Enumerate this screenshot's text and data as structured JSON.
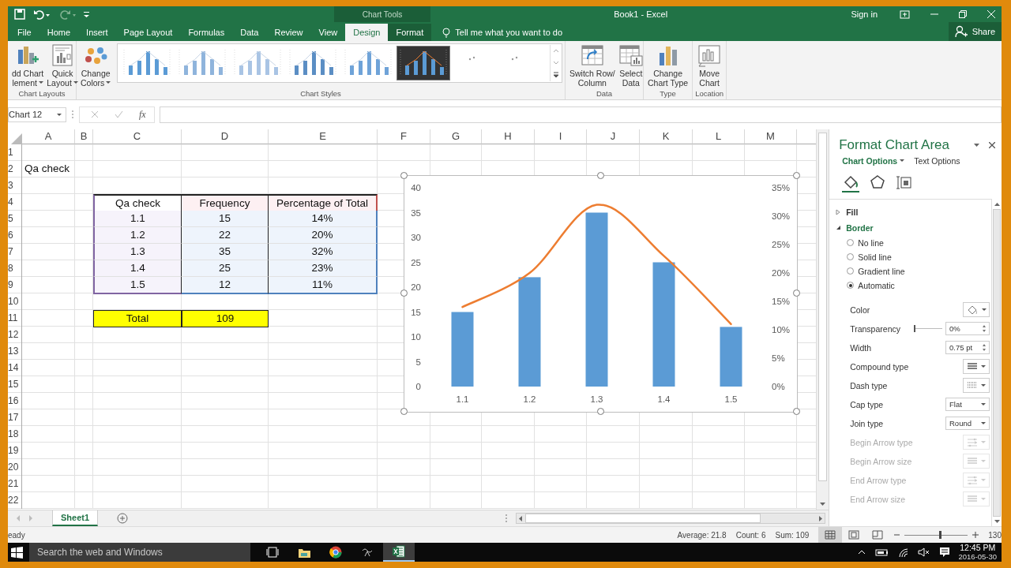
{
  "title_bar": {
    "context_label": "Chart Tools",
    "title": "Book1 - Excel",
    "sign_in": "Sign in"
  },
  "ribbon_tabs": [
    {
      "label": "File",
      "selected": false,
      "contextual": false
    },
    {
      "label": "Home",
      "selected": false,
      "contextual": false
    },
    {
      "label": "Insert",
      "selected": false,
      "contextual": false
    },
    {
      "label": "Page Layout",
      "selected": false,
      "contextual": false
    },
    {
      "label": "Formulas",
      "selected": false,
      "contextual": false
    },
    {
      "label": "Data",
      "selected": false,
      "contextual": false
    },
    {
      "label": "Review",
      "selected": false,
      "contextual": false
    },
    {
      "label": "View",
      "selected": false,
      "contextual": false
    },
    {
      "label": "Design",
      "selected": true,
      "contextual": true
    },
    {
      "label": "Format",
      "selected": false,
      "contextual": true
    }
  ],
  "tell_me": "Tell me what you want to do",
  "share": "Share",
  "ribbon_groups": [
    {
      "label": "Chart Layouts",
      "buttons": [
        {
          "lines": [
            "dd Chart",
            "lement"
          ],
          "dropdown": true
        },
        {
          "lines": [
            "Quick",
            "Layout"
          ],
          "dropdown": true
        }
      ]
    },
    {
      "label": "Chart Styles",
      "buttons": [
        {
          "lines": [
            "Change",
            "Colors"
          ],
          "dropdown": true
        }
      ],
      "gallery": [
        {
          "kind": "style",
          "selected": false
        },
        {
          "kind": "style",
          "selected": false
        },
        {
          "kind": "style",
          "selected": false
        },
        {
          "kind": "style",
          "selected": false
        },
        {
          "kind": "style",
          "selected": false
        },
        {
          "kind": "style",
          "selected": true
        },
        {
          "kind": "placeholder",
          "selected": false
        },
        {
          "kind": "placeholder",
          "selected": false
        }
      ]
    },
    {
      "label": "Data",
      "buttons": [
        {
          "lines": [
            "Switch Row/",
            "Column"
          ],
          "dropdown": false
        },
        {
          "lines": [
            "Select",
            "Data"
          ],
          "dropdown": false
        }
      ]
    },
    {
      "label": "Type",
      "buttons": [
        {
          "lines": [
            "Change",
            "Chart Type"
          ],
          "dropdown": false
        }
      ]
    },
    {
      "label": "Location",
      "buttons": [
        {
          "lines": [
            "Move",
            "Chart"
          ],
          "dropdown": false
        }
      ]
    }
  ],
  "formula_bar": {
    "name_box": "Chart 12",
    "function_label": "fx"
  },
  "sheet": {
    "columns": [
      "A",
      "B",
      "C",
      "D",
      "E",
      "F",
      "G",
      "H",
      "I",
      "J",
      "K",
      "L",
      "M"
    ],
    "rows": [
      {
        "number": "1"
      },
      {
        "number": "2",
        "label": "Qa check"
      },
      {
        "number": "3"
      },
      {
        "number": "4"
      },
      {
        "number": "5"
      },
      {
        "number": "6"
      },
      {
        "number": "7"
      },
      {
        "number": "8"
      },
      {
        "number": "9"
      },
      {
        "number": "10"
      },
      {
        "number": "11"
      },
      {
        "number": "12"
      },
      {
        "number": "13"
      },
      {
        "number": "14"
      },
      {
        "number": "15"
      },
      {
        "number": "16"
      },
      {
        "number": "17"
      },
      {
        "number": "18"
      },
      {
        "number": "19"
      },
      {
        "number": "20"
      },
      {
        "number": "21"
      },
      {
        "number": "22"
      }
    ]
  },
  "data_table": {
    "header": [
      "Qa check",
      "Frequency",
      "Percentage of Total"
    ],
    "rows": [
      [
        "1.1",
        "15",
        "14%"
      ],
      [
        "1.2",
        "22",
        "20%"
      ],
      [
        "1.3",
        "35",
        "32%"
      ],
      [
        "1.4",
        "25",
        "23%"
      ],
      [
        "1.5",
        "12",
        "11%"
      ]
    ]
  },
  "total": {
    "label": "Total",
    "value": "109"
  },
  "chart": {
    "chart_data": {
      "type": "bar",
      "categories": [
        "1.1",
        "1.2",
        "1.3",
        "1.4",
        "1.5"
      ],
      "series": [
        {
          "type": "bar",
          "color": "#5b9bd5",
          "values": [
            15,
            22,
            35,
            25,
            12
          ]
        },
        {
          "type": "line",
          "axis": "y2",
          "color": "#ed7d31",
          "values": [
            0.14,
            0.2,
            0.32,
            0.23,
            0.11
          ]
        }
      ],
      "ylim": [
        0,
        40
      ],
      "yticks": [
        0,
        5,
        10,
        15,
        20,
        25,
        30,
        35,
        40
      ],
      "y2lim": [
        0,
        0.35
      ],
      "y2ticks": [
        {
          "value": 0,
          "label": "0%"
        },
        {
          "value": 0.05,
          "label": "5%"
        },
        {
          "value": 0.1,
          "label": "10%"
        },
        {
          "value": 0.15,
          "label": "15%"
        },
        {
          "value": 0.2,
          "label": "20%"
        },
        {
          "value": 0.25,
          "label": "25%"
        },
        {
          "value": 0.3,
          "label": "30%"
        },
        {
          "value": 0.35,
          "label": "35%"
        }
      ]
    }
  },
  "sheet_tabs": [
    {
      "label": "Sheet1",
      "selected": true
    }
  ],
  "format_pane": {
    "title": "Format Chart Area",
    "option_tabs": [
      {
        "label": "Chart Options",
        "selected": true
      },
      {
        "label": "Text Options",
        "selected": false
      }
    ],
    "icon_tabs": [
      {
        "selected": true
      },
      {
        "selected": false
      },
      {
        "selected": false
      }
    ],
    "sections": [
      {
        "label": "Fill",
        "expanded": false
      },
      {
        "label": "Border",
        "expanded": true
      }
    ],
    "radios": [
      {
        "label": "No line",
        "selected": false
      },
      {
        "label": "Solid line",
        "selected": false
      },
      {
        "label": "Gradient line",
        "selected": false
      },
      {
        "label": "Automatic",
        "selected": true
      }
    ],
    "properties": [
      {
        "label": "Color",
        "kind": "color",
        "disabled": false
      },
      {
        "label": "Transparency",
        "kind": "slider",
        "level": 0,
        "value": "0%",
        "disabled": false
      },
      {
        "label": "Width",
        "kind": "spin",
        "value": "0.75 pt",
        "disabled": false
      },
      {
        "label": "Compound type",
        "kind": "lines",
        "disabled": false
      },
      {
        "label": "Dash type",
        "kind": "dash",
        "disabled": false
      },
      {
        "label": "Cap type",
        "kind": "select",
        "value": "Flat",
        "disabled": false
      },
      {
        "label": "Join type",
        "kind": "select",
        "value": "Round",
        "disabled": false
      },
      {
        "label": "Begin Arrow type",
        "kind": "arrow",
        "disabled": true
      },
      {
        "label": "Begin Arrow size",
        "kind": "lines",
        "disabled": true
      },
      {
        "label": "End Arrow type",
        "kind": "arrow",
        "disabled": true
      },
      {
        "label": "End Arrow size",
        "kind": "lines",
        "disabled": true
      }
    ]
  },
  "status_bar": {
    "mode": "eady",
    "stats": [
      "Average: 21.8",
      "Count: 6",
      "Sum: 109"
    ],
    "views": [
      {
        "selected": true
      },
      {
        "selected": false
      },
      {
        "selected": false
      }
    ],
    "zoom": {
      "level": 0.55,
      "label": "130"
    }
  },
  "taskbar": {
    "search_placeholder": "Search the web and Windows",
    "apps": [
      {
        "selected": false
      },
      {
        "selected": false
      },
      {
        "selected": false
      },
      {
        "selected": false
      },
      {
        "selected": true
      }
    ],
    "time": "12:45 PM",
    "date": "2016-05-30"
  }
}
